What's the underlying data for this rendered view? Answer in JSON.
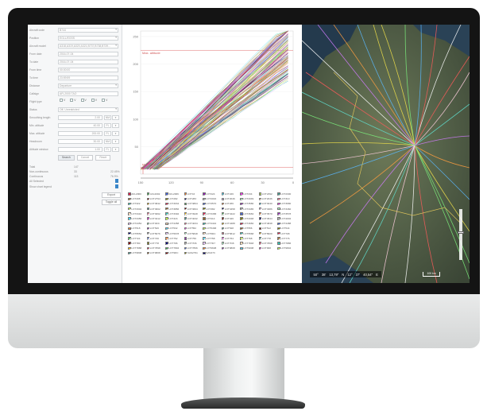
{
  "form": {
    "rows": [
      {
        "label": "Aircraft code",
        "value": "B744",
        "select": true
      },
      {
        "label": "Position",
        "value": "EGLL/EGSS",
        "select": true
      },
      {
        "label": "Aircraft model",
        "value": "A318,A319,A320,A321,B737,B738,B739...",
        "select": true
      },
      {
        "label": "From date",
        "value": "2016-07-04",
        "select": false
      },
      {
        "label": "To date",
        "value": "2016-07-04",
        "select": false
      },
      {
        "label": "From time",
        "value": "00:00:00",
        "select": false
      },
      {
        "label": "To time",
        "value": "23:59:59",
        "select": false
      },
      {
        "label": "Distance",
        "value": "Departure",
        "select": true
      },
      {
        "label": "Callsign",
        "value": "AFL2000 TAO",
        "select": false
      }
    ],
    "flight_phase_label": "Flight type",
    "flight_phases": [
      "V",
      "V",
      "V",
      "V",
      "V"
    ],
    "status": {
      "label": "Status",
      "value": "Off, Unrestricted",
      "select": true
    },
    "numeric_rows": [
      {
        "label": "Smoothing length",
        "value": "2.00",
        "unit": "NM"
      },
      {
        "label": "Min. altitude",
        "value": "40.00",
        "unit": "FL"
      },
      {
        "label": "Max. altitude",
        "value": "200.00",
        "unit": "FL"
      },
      {
        "label": "Headroom",
        "value": "30.00",
        "unit": "NM"
      },
      {
        "label": "Altitude window",
        "value": "1.00",
        "unit": "FL"
      }
    ],
    "buttons": {
      "search": "Search",
      "cancel": "Cancel",
      "reset": "Reset"
    },
    "stats": [
      {
        "label": "Total",
        "value": "147",
        "pct": ""
      },
      {
        "label": "Non-continuous",
        "value": "33",
        "pct": "22.45%"
      },
      {
        "label": "Continuous",
        "value": "113",
        "pct": "76.9%"
      }
    ],
    "toggle_rows": [
      "All Selected",
      "Show chart legend"
    ],
    "side_buttons": {
      "export": "Export",
      "toggle_all": "Toggle all"
    }
  },
  "chart_data": {
    "type": "line",
    "x_ticks": [
      "150",
      "120",
      "90",
      "60",
      "30",
      "0"
    ],
    "y_ticks": [
      "250",
      "200",
      "150",
      "100",
      "50"
    ],
    "max_label": "Max. altitude",
    "min_label": "Min. altitude",
    "xlim": [
      150,
      0
    ],
    "ylim": [
      0,
      260
    ],
    "series_count": 147
  },
  "legend": [
    "AFL2000",
    "AFL2002",
    "AFL2006",
    "LOT16",
    "LOT224",
    "LOT226",
    "LOT234",
    "LOT2392",
    "LOT2300",
    "LOT208",
    "LOT2794",
    "LOT282",
    "LOT283",
    "LOT2016",
    "LOT2046",
    "LOT2049",
    "LOT2046",
    "LOT310",
    "LOT322",
    "LOT3842",
    "LOT3034",
    "LOT3864",
    "LOT3570",
    "LOT266",
    "LOT3580",
    "LOT3040",
    "LOT3680",
    "LOT3302",
    "LOT3602",
    "LOT3856",
    "LOT3664",
    "LOT382",
    "LOT3458",
    "LOT3465",
    "LOT3386",
    "LOT3460",
    "LOT3410",
    "LOT3062",
    "LOT3392",
    "LOT3948",
    "LOT3458",
    "LOT3422",
    "LOT3684",
    "LOT3570",
    "LOT3578",
    "LOT3456",
    "LOT3412",
    "LOT416",
    "LOT4032",
    "LOT414",
    "LOT426",
    "LOT4348",
    "LOT4544",
    "LOT4002",
    "LOT4452",
    "LOT4DC",
    "LOT4458",
    "LOT4034",
    "LOT4442",
    "LOT4488",
    "LOT4682",
    "LOT4848",
    "LOT4488",
    "LOT518",
    "LOT526",
    "LOT532",
    "LOT552",
    "LOT5468",
    "LOT528",
    "LOT556",
    "LOT512",
    "LOT544",
    "LOT5552",
    "LOT5676",
    "LOT5678",
    "LOT5848",
    "LOT5DC",
    "LOT5812",
    "LOT5568",
    "LOT5820",
    "LOT708",
    "LOT724",
    "LOT726",
    "LOT752",
    "LOT756",
    "LOT758",
    "LOT764",
    "LOT768",
    "LOT778",
    "LOT776",
    "LOT780",
    "LOT778",
    "LOT796",
    "LOT7D6",
    "LOT7D7",
    "LOT7D8",
    "LOT7848",
    "LOT7868",
    "LOT7886",
    "LOT7888",
    "LOT7898",
    "LOT7894",
    "LOT7896",
    "LOT9608",
    "LOT9808",
    "LOT9008",
    "LOT908",
    "LOT9804",
    "LOT9808",
    "LOT9808",
    "LOT9DC",
    "SAS2791",
    "SAS373"
  ],
  "map": {
    "coords": [
      "50°",
      "38'",
      "13,79\"",
      "N",
      "12°",
      "37'",
      "40,54\"",
      "E"
    ],
    "scale_label": "100 km"
  }
}
